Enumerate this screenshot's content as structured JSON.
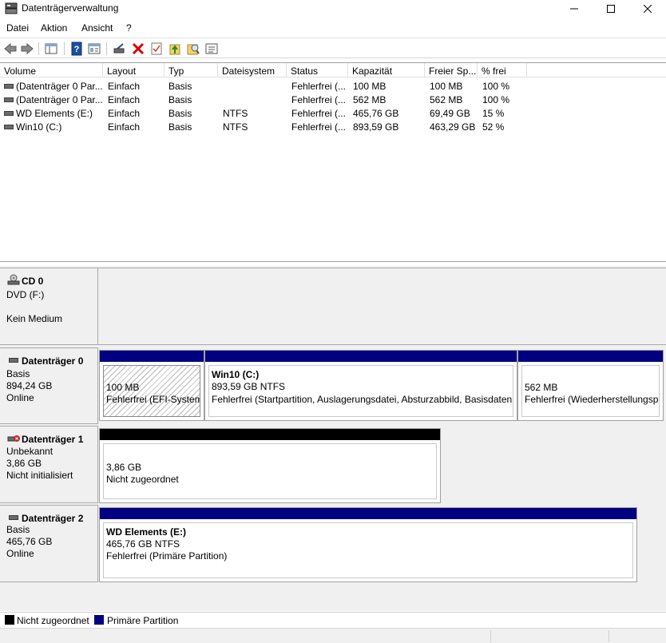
{
  "window": {
    "title": "Datenträgerverwaltung"
  },
  "menu": [
    "Datei",
    "Aktion",
    "Ansicht",
    "?"
  ],
  "toolbar": {
    "icons": [
      "back-icon",
      "forward-icon",
      "console-tree-icon",
      "help-icon",
      "properties-icon",
      "connect-icon",
      "delete-icon",
      "check-icon",
      "import-icon",
      "search-icon",
      "list-icon"
    ]
  },
  "volumes": {
    "columns": [
      "Volume",
      "Layout",
      "Typ",
      "Dateisystem",
      "Status",
      "Kapazität",
      "Freier Sp...",
      "% frei"
    ],
    "rows": [
      [
        "(Datenträger 0 Par...",
        "Einfach",
        "Basis",
        "",
        "Fehlerfrei (...",
        "100 MB",
        "100 MB",
        "100 %"
      ],
      [
        "(Datenträger 0 Par...",
        "Einfach",
        "Basis",
        "",
        "Fehlerfrei (...",
        "562 MB",
        "562 MB",
        "100 %"
      ],
      [
        "WD Elements (E:)",
        "Einfach",
        "Basis",
        "NTFS",
        "Fehlerfrei (...",
        "465,76 GB",
        "69,49 GB",
        "15 %"
      ],
      [
        "Win10 (C:)",
        "Einfach",
        "Basis",
        "NTFS",
        "Fehlerfrei (...",
        "893,59 GB",
        "463,29 GB",
        "52 %"
      ]
    ]
  },
  "disks": {
    "cd0": {
      "name": "CD 0",
      "lines": [
        "DVD (F:)",
        "",
        "Kein Medium"
      ]
    },
    "disk0": {
      "name": "Datenträger 0",
      "lines": [
        "Basis",
        "894,24 GB",
        "Online"
      ],
      "parts": [
        {
          "title": "",
          "size": "100 MB",
          "status": "Fehlerfrei (EFI-Systempartition)"
        },
        {
          "title": "Win10  (C:)",
          "size": "893,59 GB NTFS",
          "status": "Fehlerfrei (Startpartition, Auslagerungsdatei, Absturzabbild, Basisdatenpartition)"
        },
        {
          "title": "",
          "size": "562 MB",
          "status": "Fehlerfrei (Wiederherstellungspartition)"
        }
      ]
    },
    "disk1": {
      "name": "Datenträger 1",
      "lines": [
        "Unbekannt",
        "3,86 GB",
        "Nicht initialisiert"
      ],
      "parts": [
        {
          "size": "3,86 GB",
          "status": "Nicht zugeordnet"
        }
      ]
    },
    "disk2": {
      "name": "Datenträger 2",
      "lines": [
        "Basis",
        "465,76 GB",
        "Online"
      ],
      "parts": [
        {
          "title": "WD Elements  (E:)",
          "size": "465,76 GB NTFS",
          "status": "Fehlerfrei (Primäre Partition)"
        }
      ]
    }
  },
  "legend": {
    "items": [
      {
        "label": "Nicht zugeordnet",
        "color": "#000000"
      },
      {
        "label": "Primäre Partition",
        "color": "#000080"
      }
    ]
  }
}
